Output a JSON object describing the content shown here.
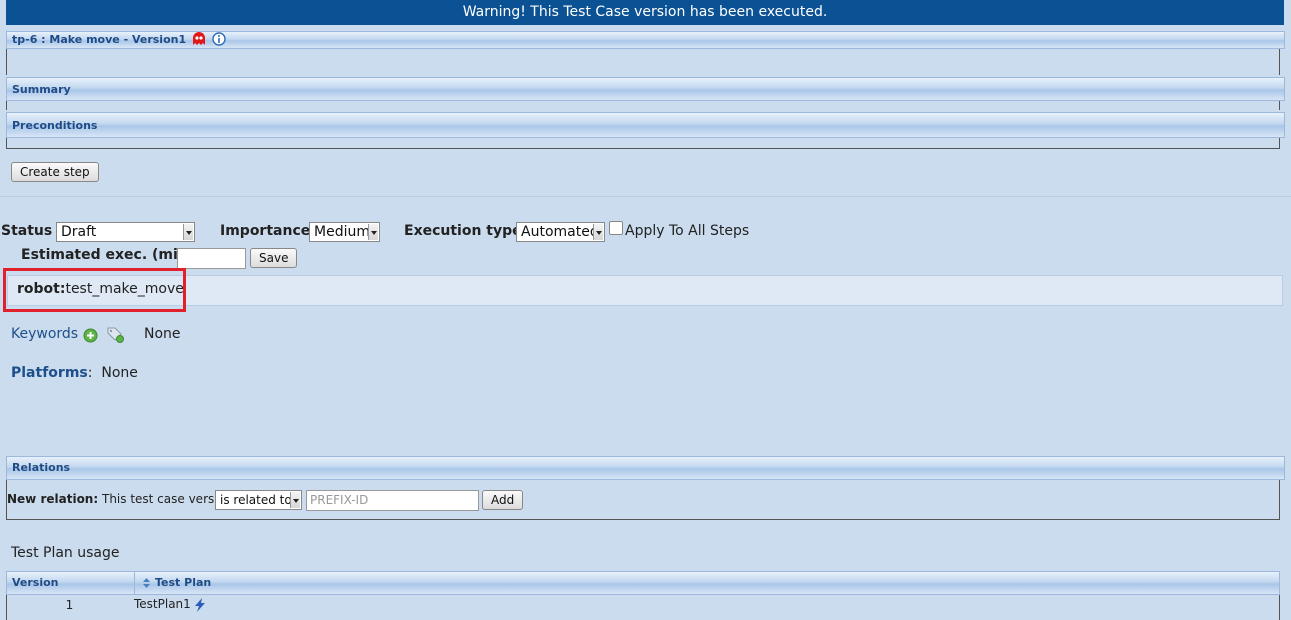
{
  "warning": "Warning! This Test Case version has been executed.",
  "testcase_title": "tp-6 : Make move - Version1",
  "sections": {
    "summary": "Summary",
    "preconditions": "Preconditions",
    "relations": "Relations"
  },
  "create_step": "Create step",
  "status": {
    "label": "Status :",
    "value": "Draft"
  },
  "importance": {
    "label": "Importance :",
    "value": "Medium"
  },
  "exec_type": {
    "label": "Execution type :",
    "value": "Automated",
    "apply_all": "Apply To All Steps"
  },
  "estimated": {
    "label": "Estimated exec. (min) :",
    "value": "",
    "save": "Save"
  },
  "custom_field": {
    "name": "robot:",
    "value": "test_make_move"
  },
  "keywords": {
    "label": "Keywords",
    "value": "None"
  },
  "platforms": {
    "label": "Platforms",
    "colon": ":",
    "value": "None"
  },
  "new_relation": {
    "label": "New relation:",
    "text": "This test case version",
    "select": "is related to",
    "placeholder": "PREFIX-ID",
    "add": "Add"
  },
  "test_plan_usage": {
    "title": "Test Plan usage",
    "headers": [
      "Version",
      "Test Plan"
    ],
    "rows": [
      {
        "version": "1",
        "plan": "TestPlan1"
      }
    ]
  },
  "colors": {
    "accent": "#0a5294",
    "highlight": "#e0202a",
    "link": "#1c4f8c"
  }
}
